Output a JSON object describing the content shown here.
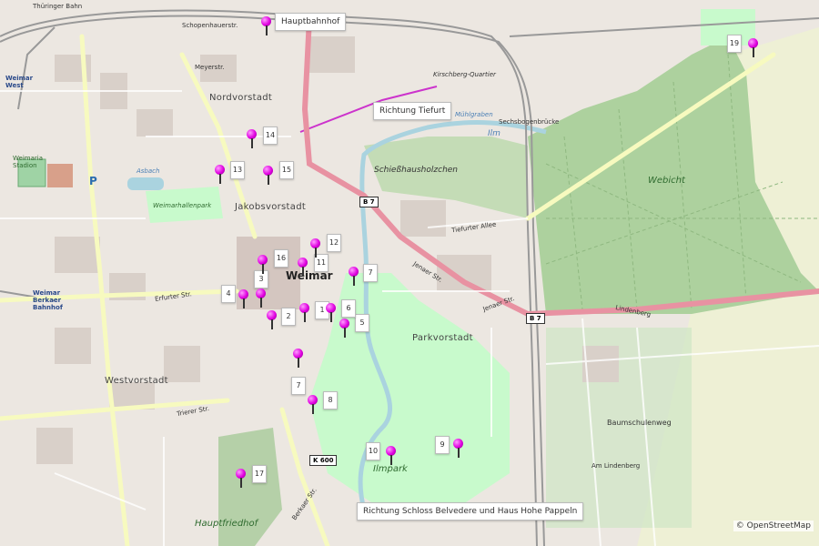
{
  "map": {
    "attribution": "© OpenStreetMap",
    "colors": {
      "pin": "#e000e0",
      "main_road": "#e892a2",
      "rail": "#999999",
      "forest": "#add19e",
      "water": "#aad3df",
      "park": "#c8facc"
    }
  },
  "callouts": {
    "hauptbahnhof": "Hauptbahnhof",
    "tiefurt": "Richtung Tiefurt",
    "belvedere": "Richtung Schloss Belvedere und Haus Hohe Pappeln"
  },
  "markers": [
    {
      "label": "1"
    },
    {
      "label": "2"
    },
    {
      "label": "3"
    },
    {
      "label": "4"
    },
    {
      "label": "5"
    },
    {
      "label": "6"
    },
    {
      "label": "7"
    },
    {
      "label": "7"
    },
    {
      "label": "8"
    },
    {
      "label": "9"
    },
    {
      "label": "10"
    },
    {
      "label": "11"
    },
    {
      "label": "12"
    },
    {
      "label": "13"
    },
    {
      "label": "14"
    },
    {
      "label": "15"
    },
    {
      "label": "16"
    },
    {
      "label": "17"
    },
    {
      "label": "19"
    }
  ],
  "place_labels": {
    "nordvorstadt": "Nordvorstadt",
    "jakobsvorstadt": "Jakobsvorstadt",
    "weimar": "Weimar",
    "westvorstadt": "Westvorstadt",
    "parkvorstadt": "Parkvorstadt",
    "webicht": "Webicht",
    "ilmpark": "Ilmpark",
    "hauptfriedhof": "Hauptfriedhof",
    "weimar_west": "Weimar West",
    "weimar_berkaer": "Weimar Berkaer Bahnhof",
    "schiesshaus": "Schießhausholzchen",
    "baumschulenweg": "Baumschulenweg",
    "am_lindenberg": "Am Lindenberg",
    "kirschberg": "Kirschberg-Quartier",
    "sechsbogen": "Sechsbogenbrücke",
    "ilm": "Ilm",
    "muehlgraben": "Mühlgraben",
    "asbach": "Asbach",
    "weimarhallenpark": "Weimarhallenpark",
    "weimaria": "Weimaria Stadion",
    "thueringer_bahn": "Thüringer Bahn",
    "parking": "P"
  },
  "street_labels": {
    "jenaer": "Jenaer Str.",
    "lindenberg": "Lindenberg",
    "erfurter": "Erfurter Str.",
    "trierer": "Trierer Str.",
    "berkaer": "Berkaer Str.",
    "tiefurter": "Tiefurter Allee",
    "schopenhauer": "Schopenhauerstr.",
    "meyerstr": "Meyerstr."
  },
  "road_shields": {
    "b7_a": "B 7",
    "b7_b": "B 7",
    "k600": "K 600"
  }
}
